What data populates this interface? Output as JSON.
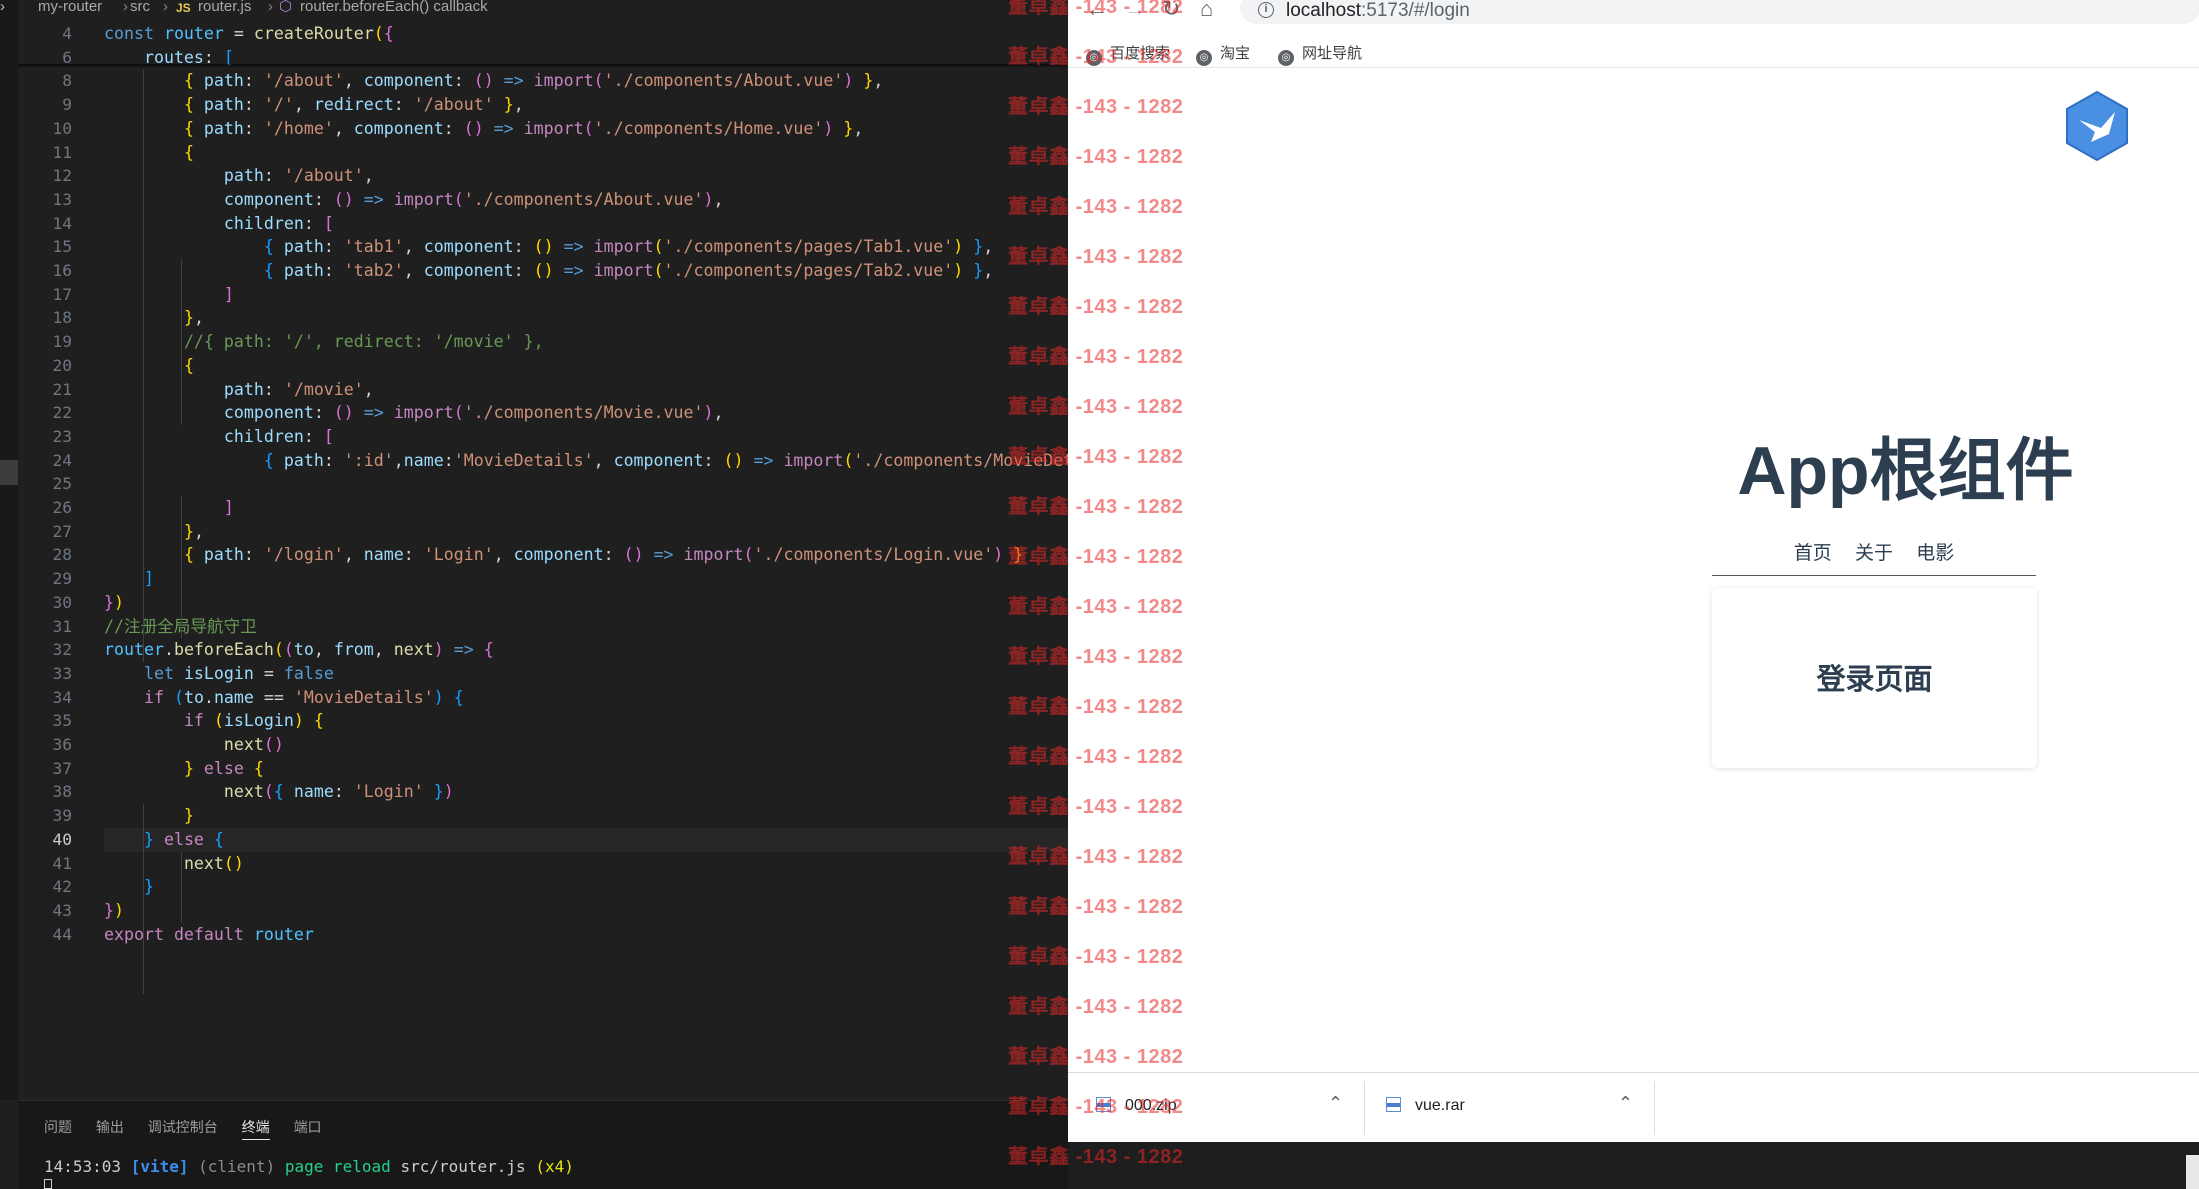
{
  "editor": {
    "breadcrumb": [
      "my-router",
      "src",
      "router.js",
      "router.beforeEach() callback"
    ],
    "current_line": 40,
    "lines": [
      {
        "n": 4,
        "tokens": [
          [
            "k",
            "const "
          ],
          [
            "cn",
            "router"
          ],
          [
            "p",
            " = "
          ],
          [
            "f",
            "createRouter"
          ],
          [
            "b1",
            "("
          ],
          [
            "b2",
            "{"
          ]
        ]
      },
      {
        "n": 6,
        "tokens": [
          [
            "p",
            "    "
          ],
          [
            "v",
            "routes"
          ],
          [
            "p",
            ": "
          ],
          [
            "b3",
            "["
          ]
        ]
      },
      {
        "n": 8,
        "tokens": [
          [
            "p",
            "        "
          ],
          [
            "b1",
            "{ "
          ],
          [
            "v",
            "path"
          ],
          [
            "p",
            ": "
          ],
          [
            "s",
            "'/about'"
          ],
          [
            "p",
            ", "
          ],
          [
            "v",
            "component"
          ],
          [
            "p",
            ": "
          ],
          [
            "b2",
            "()"
          ],
          [
            "k",
            " => "
          ],
          [
            "kc",
            "import"
          ],
          [
            "b2",
            "("
          ],
          [
            "s",
            "'./components/About.vue'"
          ],
          [
            "b2",
            ")"
          ],
          [
            "b1",
            " }"
          ],
          [
            "p",
            ","
          ]
        ]
      },
      {
        "n": 9,
        "tokens": [
          [
            "p",
            "        "
          ],
          [
            "b1",
            "{ "
          ],
          [
            "v",
            "path"
          ],
          [
            "p",
            ": "
          ],
          [
            "s",
            "'/'"
          ],
          [
            "p",
            ", "
          ],
          [
            "v",
            "redirect"
          ],
          [
            "p",
            ": "
          ],
          [
            "s",
            "'/about'"
          ],
          [
            "b1",
            " }"
          ],
          [
            "p",
            ","
          ]
        ]
      },
      {
        "n": 10,
        "tokens": [
          [
            "p",
            "        "
          ],
          [
            "b1",
            "{ "
          ],
          [
            "v",
            "path"
          ],
          [
            "p",
            ": "
          ],
          [
            "s",
            "'/home'"
          ],
          [
            "p",
            ", "
          ],
          [
            "v",
            "component"
          ],
          [
            "p",
            ": "
          ],
          [
            "b2",
            "()"
          ],
          [
            "k",
            " => "
          ],
          [
            "kc",
            "import"
          ],
          [
            "b2",
            "("
          ],
          [
            "s",
            "'./components/Home.vue'"
          ],
          [
            "b2",
            ")"
          ],
          [
            "b1",
            " }"
          ],
          [
            "p",
            ","
          ]
        ]
      },
      {
        "n": 11,
        "tokens": [
          [
            "p",
            "        "
          ],
          [
            "b1",
            "{"
          ]
        ]
      },
      {
        "n": 12,
        "tokens": [
          [
            "p",
            "            "
          ],
          [
            "v",
            "path"
          ],
          [
            "p",
            ": "
          ],
          [
            "s",
            "'/about'"
          ],
          [
            "p",
            ","
          ]
        ]
      },
      {
        "n": 13,
        "tokens": [
          [
            "p",
            "            "
          ],
          [
            "v",
            "component"
          ],
          [
            "p",
            ": "
          ],
          [
            "b2",
            "()"
          ],
          [
            "k",
            " => "
          ],
          [
            "kc",
            "import"
          ],
          [
            "b2",
            "("
          ],
          [
            "s",
            "'./components/About.vue'"
          ],
          [
            "b2",
            ")"
          ],
          [
            "p",
            ","
          ]
        ]
      },
      {
        "n": 14,
        "tokens": [
          [
            "p",
            "            "
          ],
          [
            "v",
            "children"
          ],
          [
            "p",
            ": "
          ],
          [
            "b2",
            "["
          ]
        ]
      },
      {
        "n": 15,
        "tokens": [
          [
            "p",
            "                "
          ],
          [
            "b3",
            "{ "
          ],
          [
            "v",
            "path"
          ],
          [
            "p",
            ": "
          ],
          [
            "s",
            "'tab1'"
          ],
          [
            "p",
            ", "
          ],
          [
            "v",
            "component"
          ],
          [
            "p",
            ": "
          ],
          [
            "b1",
            "()"
          ],
          [
            "k",
            " => "
          ],
          [
            "kc",
            "import"
          ],
          [
            "b1",
            "("
          ],
          [
            "s",
            "'./components/pages/Tab1.vue'"
          ],
          [
            "b1",
            ")"
          ],
          [
            "b3",
            " }"
          ],
          [
            "p",
            ","
          ]
        ]
      },
      {
        "n": 16,
        "tokens": [
          [
            "p",
            "                "
          ],
          [
            "b3",
            "{ "
          ],
          [
            "v",
            "path"
          ],
          [
            "p",
            ": "
          ],
          [
            "s",
            "'tab2'"
          ],
          [
            "p",
            ", "
          ],
          [
            "v",
            "component"
          ],
          [
            "p",
            ": "
          ],
          [
            "b1",
            "()"
          ],
          [
            "k",
            " => "
          ],
          [
            "kc",
            "import"
          ],
          [
            "b1",
            "("
          ],
          [
            "s",
            "'./components/pages/Tab2.vue'"
          ],
          [
            "b1",
            ")"
          ],
          [
            "b3",
            " }"
          ],
          [
            "p",
            ","
          ]
        ]
      },
      {
        "n": 17,
        "tokens": [
          [
            "p",
            "            "
          ],
          [
            "b2",
            "]"
          ]
        ]
      },
      {
        "n": 18,
        "tokens": [
          [
            "p",
            "        "
          ],
          [
            "b1",
            "}"
          ],
          [
            "p",
            ","
          ]
        ]
      },
      {
        "n": 19,
        "tokens": [
          [
            "p",
            "        "
          ],
          [
            "c",
            "//{ path: '/', redirect: '/movie' },"
          ]
        ]
      },
      {
        "n": 20,
        "tokens": [
          [
            "p",
            "        "
          ],
          [
            "b1",
            "{"
          ]
        ]
      },
      {
        "n": 21,
        "tokens": [
          [
            "p",
            "            "
          ],
          [
            "v",
            "path"
          ],
          [
            "p",
            ": "
          ],
          [
            "s",
            "'/movie'"
          ],
          [
            "p",
            ","
          ]
        ]
      },
      {
        "n": 22,
        "tokens": [
          [
            "p",
            "            "
          ],
          [
            "v",
            "component"
          ],
          [
            "p",
            ": "
          ],
          [
            "b2",
            "()"
          ],
          [
            "k",
            " => "
          ],
          [
            "kc",
            "import"
          ],
          [
            "b2",
            "("
          ],
          [
            "s",
            "'./components/Movie.vue'"
          ],
          [
            "b2",
            ")"
          ],
          [
            "p",
            ","
          ]
        ]
      },
      {
        "n": 23,
        "tokens": [
          [
            "p",
            "            "
          ],
          [
            "v",
            "children"
          ],
          [
            "p",
            ": "
          ],
          [
            "b2",
            "["
          ]
        ]
      },
      {
        "n": 24,
        "tokens": [
          [
            "p",
            "                "
          ],
          [
            "b3",
            "{ "
          ],
          [
            "v",
            "path"
          ],
          [
            "p",
            ": "
          ],
          [
            "s",
            "':id'"
          ],
          [
            "p",
            ","
          ],
          [
            "v",
            "name"
          ],
          [
            "p",
            ":"
          ],
          [
            "s",
            "'MovieDetails'"
          ],
          [
            "p",
            ", "
          ],
          [
            "v",
            "component"
          ],
          [
            "p",
            ": "
          ],
          [
            "b1",
            "()"
          ],
          [
            "k",
            " => "
          ],
          [
            "kc",
            "import"
          ],
          [
            "b1",
            "("
          ],
          [
            "s",
            "'./components/MovieDetails"
          ]
        ]
      },
      {
        "n": 25,
        "tokens": []
      },
      {
        "n": 26,
        "tokens": [
          [
            "p",
            "            "
          ],
          [
            "b2",
            "]"
          ]
        ]
      },
      {
        "n": 27,
        "tokens": [
          [
            "p",
            "        "
          ],
          [
            "b1",
            "}"
          ],
          [
            "p",
            ","
          ]
        ]
      },
      {
        "n": 28,
        "tokens": [
          [
            "p",
            "        "
          ],
          [
            "b1",
            "{ "
          ],
          [
            "v",
            "path"
          ],
          [
            "p",
            ": "
          ],
          [
            "s",
            "'/login'"
          ],
          [
            "p",
            ", "
          ],
          [
            "v",
            "name"
          ],
          [
            "p",
            ": "
          ],
          [
            "s",
            "'Login'"
          ],
          [
            "p",
            ", "
          ],
          [
            "v",
            "component"
          ],
          [
            "p",
            ": "
          ],
          [
            "b2",
            "()"
          ],
          [
            "k",
            " => "
          ],
          [
            "kc",
            "import"
          ],
          [
            "b2",
            "("
          ],
          [
            "s",
            "'./components/Login.vue'"
          ],
          [
            "b2",
            ")"
          ],
          [
            "b1",
            " }"
          ]
        ]
      },
      {
        "n": 29,
        "tokens": [
          [
            "p",
            "    "
          ],
          [
            "b3",
            "]"
          ]
        ]
      },
      {
        "n": 30,
        "tokens": [
          [
            "b2",
            "}"
          ],
          [
            "b1",
            ")"
          ]
        ]
      },
      {
        "n": 31,
        "tokens": [
          [
            "c",
            "//注册全局导航守卫"
          ]
        ]
      },
      {
        "n": 32,
        "tokens": [
          [
            "cn",
            "router"
          ],
          [
            "p",
            "."
          ],
          [
            "f",
            "beforeEach"
          ],
          [
            "b1",
            "("
          ],
          [
            "b2",
            "("
          ],
          [
            "v",
            "to"
          ],
          [
            "p",
            ", "
          ],
          [
            "v",
            "from"
          ],
          [
            "p",
            ", "
          ],
          [
            "f",
            "next"
          ],
          [
            "b2",
            ")"
          ],
          [
            "k",
            " => "
          ],
          [
            "b2",
            "{"
          ]
        ]
      },
      {
        "n": 33,
        "tokens": [
          [
            "p",
            "    "
          ],
          [
            "k",
            "let "
          ],
          [
            "v",
            "isLogin"
          ],
          [
            "p",
            " = "
          ],
          [
            "k",
            "false"
          ]
        ]
      },
      {
        "n": 34,
        "tokens": [
          [
            "p",
            "    "
          ],
          [
            "kc",
            "if "
          ],
          [
            "b3",
            "("
          ],
          [
            "v",
            "to"
          ],
          [
            "p",
            "."
          ],
          [
            "v",
            "name"
          ],
          [
            "p",
            " == "
          ],
          [
            "s",
            "'MovieDetails'"
          ],
          [
            "b3",
            ")"
          ],
          [
            "b3",
            " {"
          ]
        ]
      },
      {
        "n": 35,
        "tokens": [
          [
            "p",
            "        "
          ],
          [
            "kc",
            "if "
          ],
          [
            "b1",
            "("
          ],
          [
            "v",
            "isLogin"
          ],
          [
            "b1",
            ")"
          ],
          [
            "b1",
            " {"
          ]
        ]
      },
      {
        "n": 36,
        "tokens": [
          [
            "p",
            "            "
          ],
          [
            "f",
            "next"
          ],
          [
            "b2",
            "()"
          ]
        ]
      },
      {
        "n": 37,
        "tokens": [
          [
            "p",
            "        "
          ],
          [
            "b1",
            "}"
          ],
          [
            "kc",
            " else "
          ],
          [
            "b1",
            "{"
          ]
        ]
      },
      {
        "n": 38,
        "tokens": [
          [
            "p",
            "            "
          ],
          [
            "f",
            "next"
          ],
          [
            "b2",
            "("
          ],
          [
            "b3",
            "{ "
          ],
          [
            "v",
            "name"
          ],
          [
            "p",
            ": "
          ],
          [
            "s",
            "'Login'"
          ],
          [
            "b3",
            " }"
          ],
          [
            "b2",
            ")"
          ]
        ]
      },
      {
        "n": 39,
        "tokens": [
          [
            "p",
            "        "
          ],
          [
            "b1",
            "}"
          ]
        ]
      },
      {
        "n": 40,
        "tokens": [
          [
            "p",
            "    "
          ],
          [
            "b3",
            "}"
          ],
          [
            "kc",
            " else "
          ],
          [
            "b3",
            "{"
          ]
        ]
      },
      {
        "n": 41,
        "tokens": [
          [
            "p",
            "        "
          ],
          [
            "f",
            "next"
          ],
          [
            "b1",
            "()"
          ]
        ]
      },
      {
        "n": 42,
        "tokens": [
          [
            "p",
            "    "
          ],
          [
            "b3",
            "}"
          ]
        ]
      },
      {
        "n": 43,
        "tokens": [
          [
            "b2",
            "}"
          ],
          [
            "b1",
            ")"
          ]
        ]
      },
      {
        "n": 44,
        "tokens": [
          [
            "kc",
            "export "
          ],
          [
            "kc",
            "default "
          ],
          [
            "cn",
            "router"
          ]
        ]
      }
    ]
  },
  "panel": {
    "tabs": [
      "问题",
      "输出",
      "调试控制台",
      "终端",
      "端口"
    ],
    "active_tab": "终端",
    "terminal": {
      "time": "14:53:03",
      "tag": "[vite]",
      "client": "(client)",
      "msg": "page reload",
      "file": "src/router.js",
      "count": "(x4)"
    }
  },
  "browser": {
    "url_host": "localhost",
    "url_rest": ":5173/#/login",
    "bookmarks": [
      "百度搜索",
      "淘宝",
      "网址导航"
    ],
    "app": {
      "title": "App根组件",
      "nav": [
        "首页",
        "关于",
        "电影"
      ],
      "page_title": "登录页面"
    },
    "downloads": [
      "000.zip",
      "vue.rar"
    ]
  },
  "watermark": {
    "name": "董卓鑫",
    "code": "-143 - 1282",
    "color": "#e62828"
  }
}
